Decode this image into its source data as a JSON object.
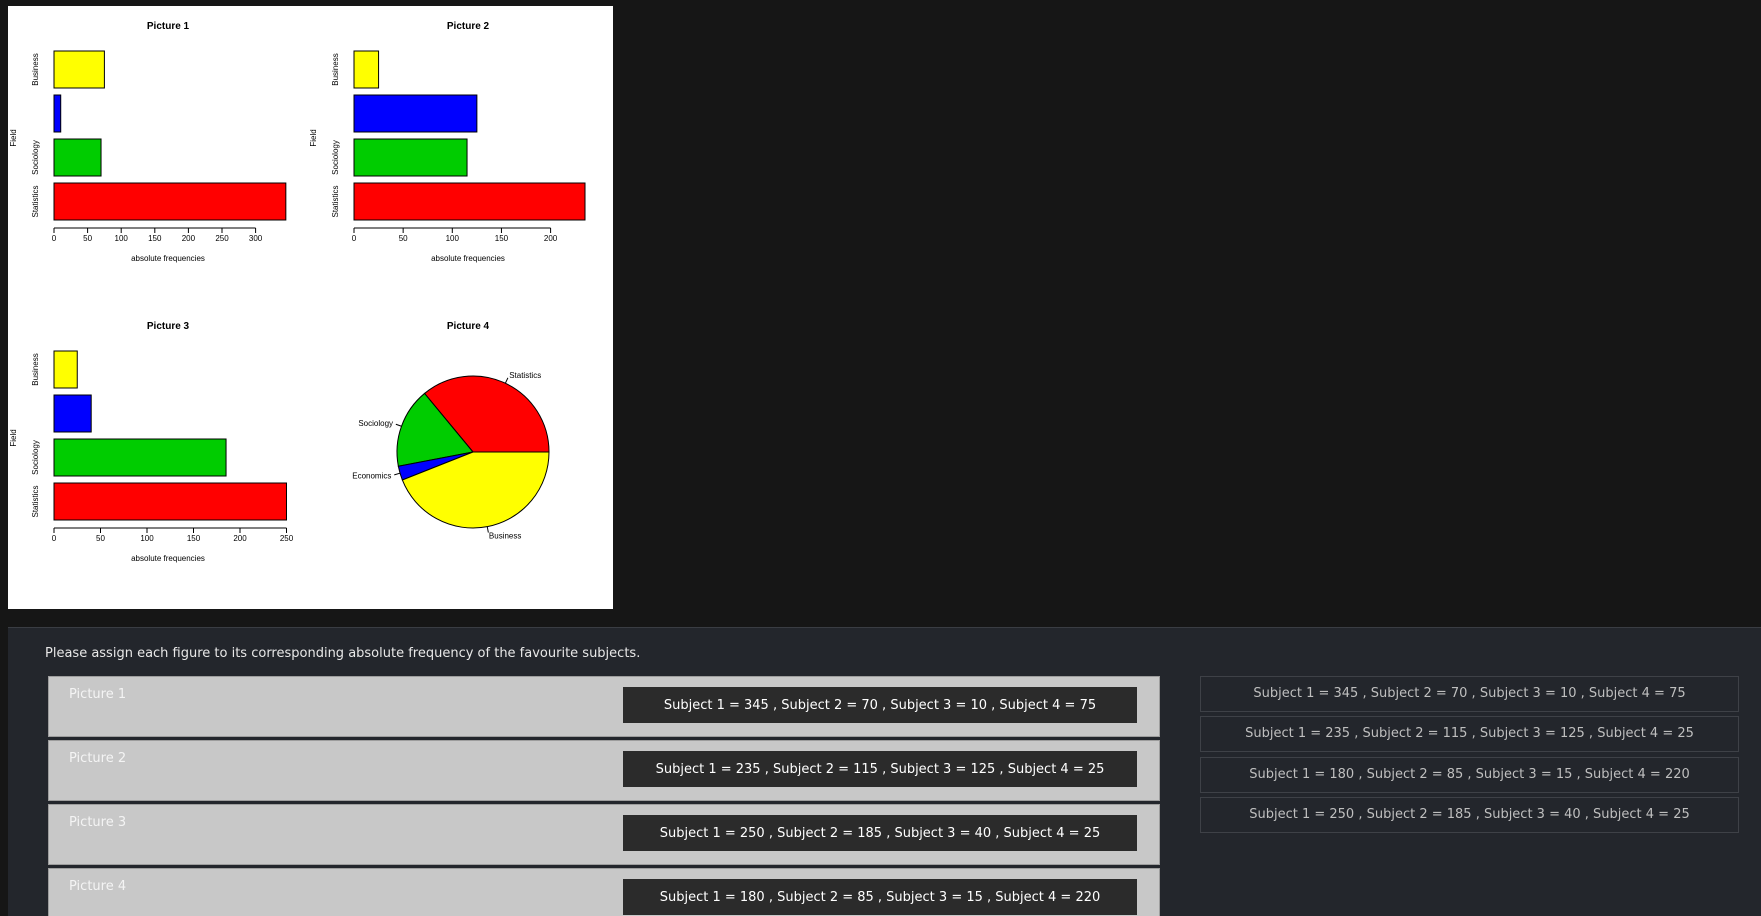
{
  "figures": [
    {
      "title": "Picture 1",
      "type": "barh",
      "categories": [
        "Statistics",
        "Sociology",
        "Economics",
        "Business"
      ],
      "category_tick_labels": [
        "Statistics",
        "Sociology",
        "",
        "Business"
      ],
      "values": [
        345,
        70,
        10,
        75
      ],
      "colors": [
        "#ff0000",
        "#00cc00",
        "#0000ff",
        "#ffff00"
      ],
      "xlim": [
        0,
        345
      ],
      "ticks": [
        0,
        50,
        100,
        150,
        200,
        250,
        300
      ],
      "xlabel": "absolute frequencies",
      "ylabel": "Field"
    },
    {
      "title": "Picture 2",
      "type": "barh",
      "categories": [
        "Statistics",
        "Sociology",
        "Economics",
        "Business"
      ],
      "category_tick_labels": [
        "Statistics",
        "Sociology",
        "",
        "Business"
      ],
      "values": [
        235,
        115,
        125,
        25
      ],
      "colors": [
        "#ff0000",
        "#00cc00",
        "#0000ff",
        "#ffff00"
      ],
      "xlim": [
        0,
        235
      ],
      "ticks": [
        0,
        50,
        100,
        150,
        200
      ],
      "xlabel": "absolute frequencies",
      "ylabel": "Field"
    },
    {
      "title": "Picture 3",
      "type": "barh",
      "categories": [
        "Statistics",
        "Sociology",
        "Economics",
        "Business"
      ],
      "category_tick_labels": [
        "Statistics",
        "Sociology",
        "",
        "Business"
      ],
      "values": [
        250,
        185,
        40,
        25
      ],
      "colors": [
        "#ff0000",
        "#00cc00",
        "#0000ff",
        "#ffff00"
      ],
      "xlim": [
        0,
        250
      ],
      "ticks": [
        0,
        50,
        100,
        150,
        200,
        250
      ],
      "xlabel": "absolute frequencies",
      "ylabel": "Field"
    },
    {
      "title": "Picture 4",
      "type": "pie",
      "categories": [
        "Statistics",
        "Sociology",
        "Economics",
        "Business"
      ],
      "values": [
        180,
        85,
        15,
        220
      ],
      "colors": [
        "#ff0000",
        "#00cc00",
        "#0000ff",
        "#ffff00"
      ],
      "slice_labels": [
        "Statistics",
        "Sociology",
        "Economics",
        "Business"
      ]
    }
  ],
  "question": {
    "prompt": "Please assign each figure to its corresponding absolute frequency of the favourite subjects.",
    "rows": [
      {
        "label": "Picture 1",
        "answer": "Subject 1 = 345 , Subject 2 = 70 , Subject 3 = 10 , Subject 4 = 75"
      },
      {
        "label": "Picture 2",
        "answer": "Subject 1 = 235 , Subject 2 = 115 , Subject 3 = 125 , Subject 4 = 25"
      },
      {
        "label": "Picture 3",
        "answer": "Subject 1 = 250 , Subject 2 = 185 , Subject 3 = 40 , Subject 4 = 25"
      },
      {
        "label": "Picture 4",
        "answer": "Subject 1 = 180 , Subject 2 = 85 , Subject 3 = 15 , Subject 4 = 220"
      }
    ],
    "options": [
      "Subject 1 = 345 , Subject 2 = 70 , Subject 3 = 10 , Subject 4 = 75",
      "Subject 1 = 235 , Subject 2 = 115 , Subject 3 = 125 , Subject 4 = 25",
      "Subject 1 = 180 , Subject 2 = 85 , Subject 3 = 15 , Subject 4 = 220",
      "Subject 1 = 250 , Subject 2 = 185 , Subject 3 = 40 , Subject 4 = 25"
    ]
  },
  "chart_data": [
    {
      "type": "bar",
      "orientation": "horizontal",
      "title": "Picture 1",
      "categories": [
        "Statistics",
        "Sociology",
        "Economics",
        "Business"
      ],
      "values": [
        345,
        70,
        10,
        75
      ],
      "xlabel": "absolute frequencies",
      "ylabel": "Field",
      "xlim": [
        0,
        345
      ]
    },
    {
      "type": "bar",
      "orientation": "horizontal",
      "title": "Picture 2",
      "categories": [
        "Statistics",
        "Sociology",
        "Economics",
        "Business"
      ],
      "values": [
        235,
        115,
        125,
        25
      ],
      "xlabel": "absolute frequencies",
      "ylabel": "Field",
      "xlim": [
        0,
        235
      ]
    },
    {
      "type": "bar",
      "orientation": "horizontal",
      "title": "Picture 3",
      "categories": [
        "Statistics",
        "Sociology",
        "Economics",
        "Business"
      ],
      "values": [
        250,
        185,
        40,
        25
      ],
      "xlabel": "absolute frequencies",
      "ylabel": "Field",
      "xlim": [
        0,
        250
      ]
    },
    {
      "type": "pie",
      "title": "Picture 4",
      "categories": [
        "Statistics",
        "Sociology",
        "Economics",
        "Business"
      ],
      "values": [
        180,
        85,
        15,
        220
      ]
    }
  ]
}
